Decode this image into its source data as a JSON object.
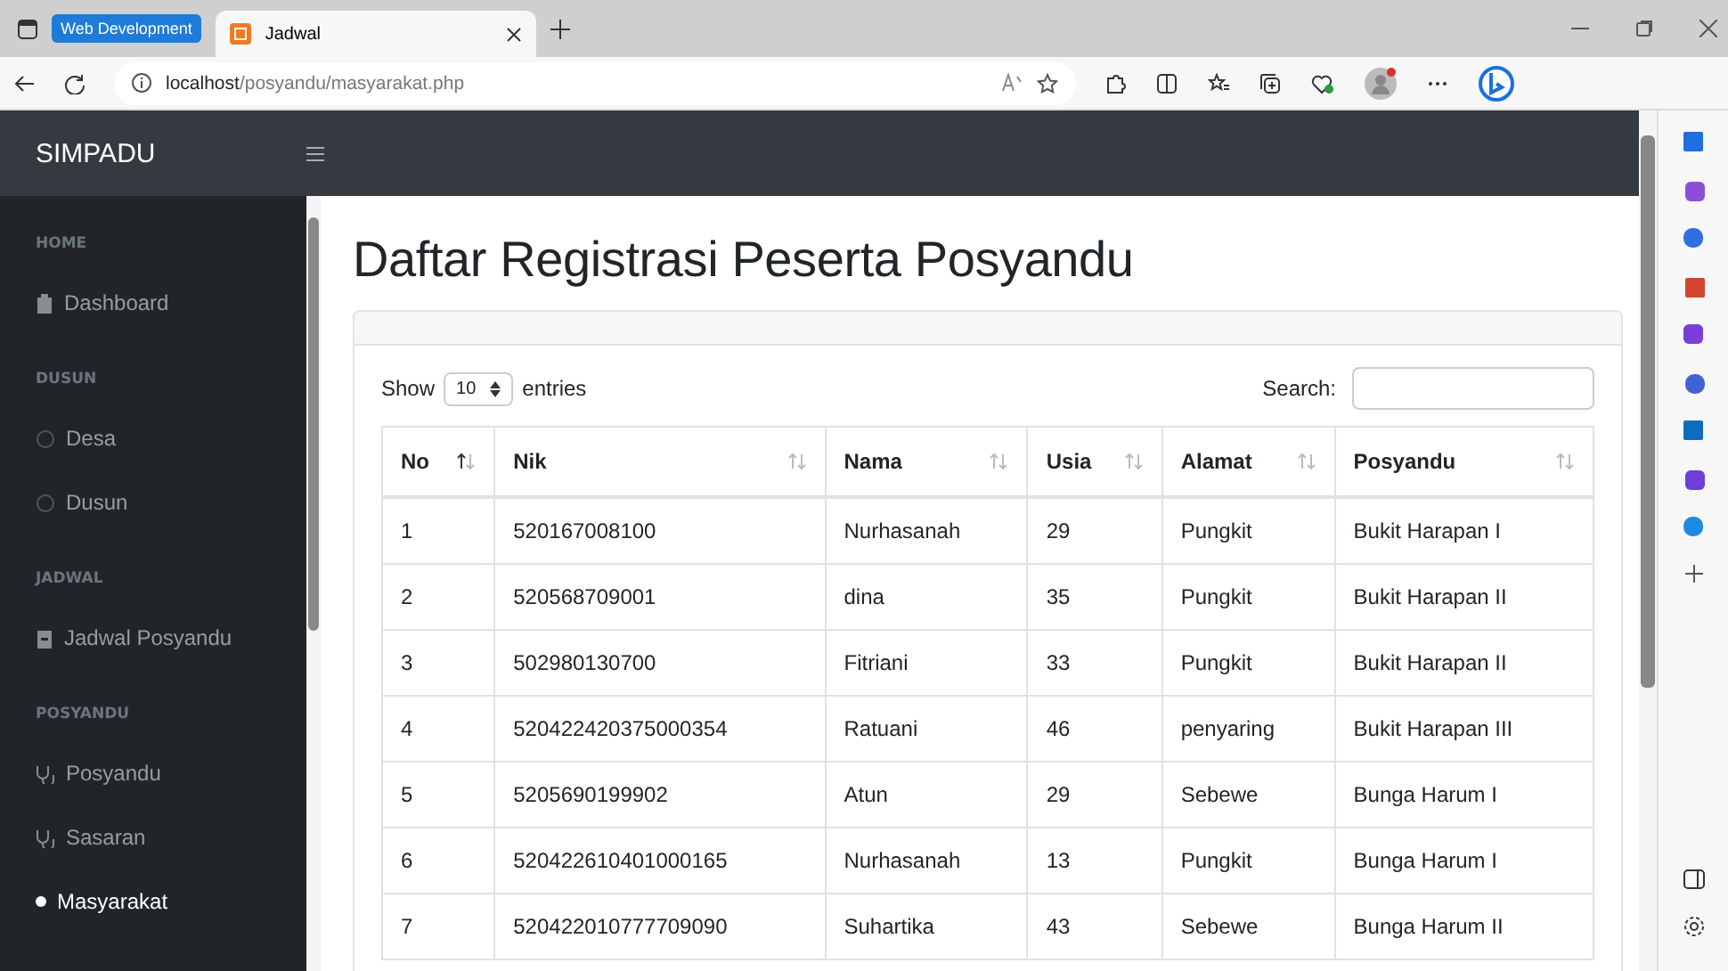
{
  "browser": {
    "tab_group": "Web Development",
    "tabs": [
      {
        "title": "Jadwal",
        "selected": true
      }
    ],
    "url_host": "localhost",
    "url_path": "/posyandu/masyarakat.php"
  },
  "app": {
    "brand": "SIMPADU"
  },
  "sidebar": {
    "sections": [
      {
        "heading": "HOME",
        "items": [
          {
            "label": "Dashboard",
            "selected": false
          }
        ]
      },
      {
        "heading": "DUSUN",
        "items": [
          {
            "label": "Desa",
            "selected": false
          },
          {
            "label": "Dusun",
            "selected": false
          }
        ]
      },
      {
        "heading": "JADWAL",
        "items": [
          {
            "label": "Jadwal Posyandu",
            "selected": false
          }
        ]
      },
      {
        "heading": "POSYANDU",
        "items": [
          {
            "label": "Posyandu",
            "selected": false
          },
          {
            "label": "Sasaran",
            "selected": false
          },
          {
            "label": "Masyarakat",
            "selected": true
          }
        ]
      }
    ]
  },
  "page_title": "Daftar Registrasi Peserta Posyandu",
  "table_controls": {
    "show_label": "Show",
    "page_size": "10",
    "entries_label": "entries",
    "search_label": "Search:"
  },
  "table": {
    "columns": [
      {
        "label": "No",
        "sorted": true
      },
      {
        "label": "Nik",
        "sorted": false
      },
      {
        "label": "Nama",
        "sorted": false
      },
      {
        "label": "Usia",
        "sorted": false
      },
      {
        "label": "Alamat",
        "sorted": false
      },
      {
        "label": "Posyandu",
        "sorted": false
      }
    ],
    "rows": [
      [
        "1",
        "520167008100",
        "Nurhasanah",
        "29",
        "Pungkit",
        "Bukit Harapan I"
      ],
      [
        "2",
        "520568709001",
        "dina",
        "35",
        "Pungkit",
        "Bukit Harapan II"
      ],
      [
        "3",
        "502980130700",
        "Fitriani",
        "33",
        "Pungkit",
        "Bukit Harapan II"
      ],
      [
        "4",
        "520422420375000354",
        "Ratuani",
        "46",
        "penyaring",
        "Bukit Harapan III"
      ],
      [
        "5",
        "5205690199902",
        "Atun",
        "29",
        "Sebewe",
        "Bunga Harum I"
      ],
      [
        "6",
        "520422610401000165",
        "Nurhasanah",
        "13",
        "Pungkit",
        "Bunga Harum I"
      ],
      [
        "7",
        "520422010777709090",
        "Suhartika",
        "43",
        "Sebewe",
        "Bunga Harum II"
      ]
    ]
  }
}
